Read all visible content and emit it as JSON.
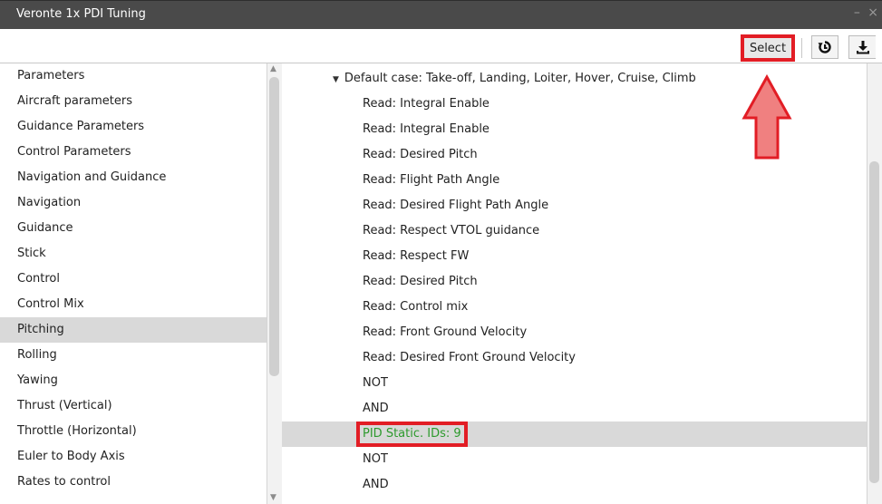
{
  "window": {
    "title": "Veronte 1x PDI Tuning",
    "controls": "– ×"
  },
  "toolbar": {
    "select_label": "Select",
    "buttons": [
      {
        "icon": "reset-icon"
      },
      {
        "icon": "download-icon"
      }
    ],
    "highlight_color": "#e21d25"
  },
  "left_panel": {
    "items": [
      "Parameters",
      "Aircraft parameters",
      "Guidance Parameters",
      "Control Parameters",
      "Navigation and Guidance",
      "Navigation",
      "Guidance",
      "Stick",
      "Control",
      "Control Mix",
      "Pitching",
      "Rolling",
      "Yawing",
      "Thrust (Vertical)",
      "Throttle (Horizontal)",
      "Euler to Body Axis",
      "Rates to control"
    ],
    "selected": "Pitching"
  },
  "right_panel": {
    "header": "Default case: Take-off, Landing, Loiter, Hover, Cruise, Climb",
    "items": [
      "Read: Integral Enable",
      "Read: Integral Enable",
      "Read: Desired Pitch",
      "Read: Flight Path Angle",
      "Read: Desired Flight Path Angle",
      "Read: Respect VTOL guidance",
      "Read: Respect FW",
      "Read: Desired Pitch",
      "Read: Control mix",
      "Read: Front Ground Velocity",
      "Read: Desired Front Ground Velocity",
      "NOT",
      "AND",
      "PID Static. IDs: 9",
      "NOT",
      "AND"
    ],
    "selected_item": "PID Static. IDs: 9",
    "selected_text_color": "#2d9a2d"
  },
  "annotation": {
    "arrow_color": "#f08080",
    "arrow_border_color": "#e21d25"
  }
}
